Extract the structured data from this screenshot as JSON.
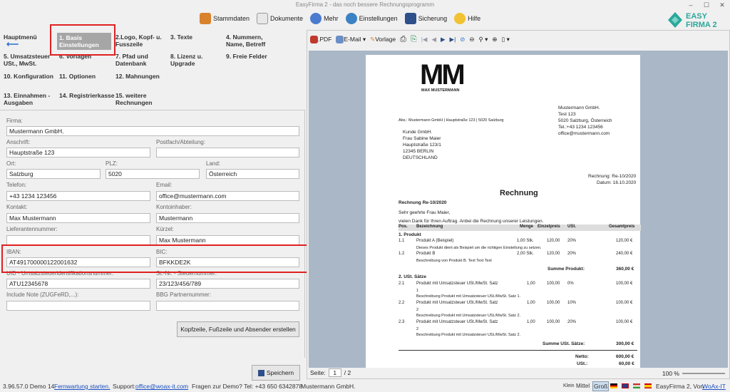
{
  "window": {
    "title": "EasyFirma 2 - das noch bessere Rechnungsprogramm"
  },
  "topmenu": {
    "stammdaten": "Stammdaten",
    "dokumente": "Dokumente",
    "mehr": "Mehr",
    "einstellungen": "Einstellungen",
    "sicherung": "Sicherung",
    "hilfe": "Hilfe"
  },
  "logo": {
    "line1": "EASY",
    "line2": "FIRMA 2"
  },
  "nav": {
    "hauptmenu": "Hauptmenü",
    "basis": "1. Basis Einstellungen",
    "logo": "2.Logo, Kopf- u. Fusszeile",
    "texte": "3. Texte",
    "nummern": "4. Nummern, Name, Betreff",
    "ust": "5. Umsatzsteuer USt., MwSt.",
    "vorlagen": "6. Vorlagen",
    "pfad": "7. Pfad und Datenbank",
    "lizenz": "8. Lizenz u. Upgrade",
    "freie": "9. Freie Felder",
    "konfig": "10. Konfiguration",
    "optionen": "11. Optionen",
    "mahnungen": "12. Mahnungen",
    "einnahmen": "13. Einnahmen - Ausgaben",
    "register": "14. Registrierkasse",
    "weitere": "15. weitere Rechnungen"
  },
  "form": {
    "firma_label": "Firma:",
    "firma": "Mustermann GmbH.",
    "anschrift_label": "Anschrift:",
    "anschrift": "Hauptstraße 123",
    "postfach_label": "Postfach/Abteilung:",
    "postfach": "",
    "ort_label": "Ort:",
    "ort": "Salzburg",
    "plz_label": "PLZ:",
    "plz": "5020",
    "land_label": "Land:",
    "land": "Österreich",
    "telefon_label": "Telefon:",
    "telefon": "+43 1234 123456",
    "email_label": "Email:",
    "email": "office@mustermann.com",
    "kontakt_label": "Kontakt:",
    "kontakt": "Max Mustermann",
    "kontoinhaber_label": "Kontoinhaber:",
    "kontoinhaber": "Mustermann",
    "lieferant_label": "Lieferantennummer:",
    "lieferant": "",
    "kuerzel_label": "Kürzel:",
    "kuerzel": "Max Mustermann",
    "iban_label": "IBAN:",
    "iban": "AT491700000122001632",
    "bic_label": "BIC:",
    "bic": "BFKKDE2K",
    "uid_label": "UID - Umsatzsteueridentifikationsnummer:",
    "uid": "ATU12345678",
    "stnr_label": "St.-Nr. - Steuernummer:",
    "stnr": "23/123/456/789",
    "note_label": "Include Note (ZUGFeRD,...):",
    "note": "",
    "bbg_label": "BBG Partnernummer:",
    "bbg": "",
    "kopf_button": "Kopfzeile, Fußzeile und Absender erstellen",
    "save_button": "Speichern"
  },
  "preview": {
    "pdf": ".PDF",
    "email": "E-Mail",
    "vorlage": "Vorlage",
    "page_label": "Seite:",
    "page_current": "1",
    "page_total": "/ 2",
    "zoom": "100 %",
    "logo_text": "MM",
    "logo_sub": "MAX MUSTERMANN",
    "sender_line": "Abs.: Mustermann GmbH | Hauptstraße 123 | 5020 Salzburg",
    "company": [
      "Mustermann GmbH.",
      "Test 123",
      "5020 Salzburg, Österreich",
      "Tel.:+43 1234 123456",
      "office@mustermann.com"
    ],
    "recipient": [
      "Kunde GmbH.",
      "Frau Sabine Maier",
      "Hauptstraße 123/1",
      "12345 BERLIN",
      "DEUTSCHLAND"
    ],
    "invoice_no": "Rechnung: Re-10/2020",
    "invoice_date": "Datum: 16.10.2020",
    "heading": "Rechnung",
    "subject": "Rechnung Re-10/2020",
    "greeting": "Sehr geehrte Frau Maier,",
    "intro": "vielen Dank für Ihren Auftrag. Anbei die Rechnung unserer Leistungen.",
    "cols": {
      "pos": "Pos.",
      "bez": "Bezeichnung",
      "menge": "Menge",
      "ep": "Einzelpreis",
      "ust": "USt.",
      "gp": "Gesamtpreis"
    },
    "sec1": "1. Produkt",
    "r11": {
      "pos": "1.1",
      "bez": "Produkt A (Beispiel)",
      "menge": "1,00 Stk.",
      "ep": "120,00",
      "ust": "20%",
      "gp": "120,00 €",
      "desc": "Dieses Produkt dient als Beispiel um die richtigen Einstellung zu setzen."
    },
    "r12": {
      "pos": "1.2",
      "bez": "Produkt B",
      "menge": "2,00 Stk.",
      "ep": "120,00",
      "ust": "20%",
      "gp": "240,00 €",
      "desc": "Beschreibung von Produkt B. Text Text Text"
    },
    "sum1_label": "Summe Produkt:",
    "sum1": "360,00 €",
    "sec2": "2. USt. Sätze",
    "r21": {
      "pos": "2.1",
      "bez": "Produkt mit Umsatzsteuer USt./MwSt. Satz",
      "n": "1",
      "menge": "1,00",
      "ep": "100,00",
      "ust": "0%",
      "gp": "100,00 €",
      "desc": "Beschreibung Produkt mit Umsatzsteuer USt./MwSt. Satz 1."
    },
    "r22": {
      "pos": "2.2",
      "bez": "Produkt mit Umsatzsteuer USt./MwSt. Satz",
      "n": "2",
      "menge": "1,00",
      "ep": "100,00",
      "ust": "10%",
      "gp": "100,00 €",
      "desc": "Beschreibung Produkt mit Umsatzsteuer USt./MwSt. Satz 2."
    },
    "r23": {
      "pos": "2.3",
      "bez": "Produkt mit Umsatzsteuer USt./MwSt. Satz",
      "n": "2",
      "menge": "1,00",
      "ep": "100,00",
      "ust": "20%",
      "gp": "100,00 €",
      "desc": "Beschreibung Produkt mit Umsatzsteuer USt./MwSt. Satz 2."
    },
    "sum2_label": "Summe USt. Sätze:",
    "sum2": "300,00 €",
    "netto_label": "Netto:",
    "netto": "600,00 €",
    "ust_label": "USt.:",
    "ust_total": "60,00 €"
  },
  "status": {
    "version": "3.96.57.0 Demo 14",
    "fernwartung": "Fernwartung starten.",
    "support": "Support:",
    "support_email": "office@woax-it.com",
    "fragen": "Fragen zur Demo? Tel: +43 650 6342878",
    "company": "Mustermann GmbH.",
    "klein": "Klein",
    "mittel": "Mittel",
    "gross": "Groß",
    "credit": "EasyFirma 2, Von",
    "woax": "WoAx-IT"
  }
}
